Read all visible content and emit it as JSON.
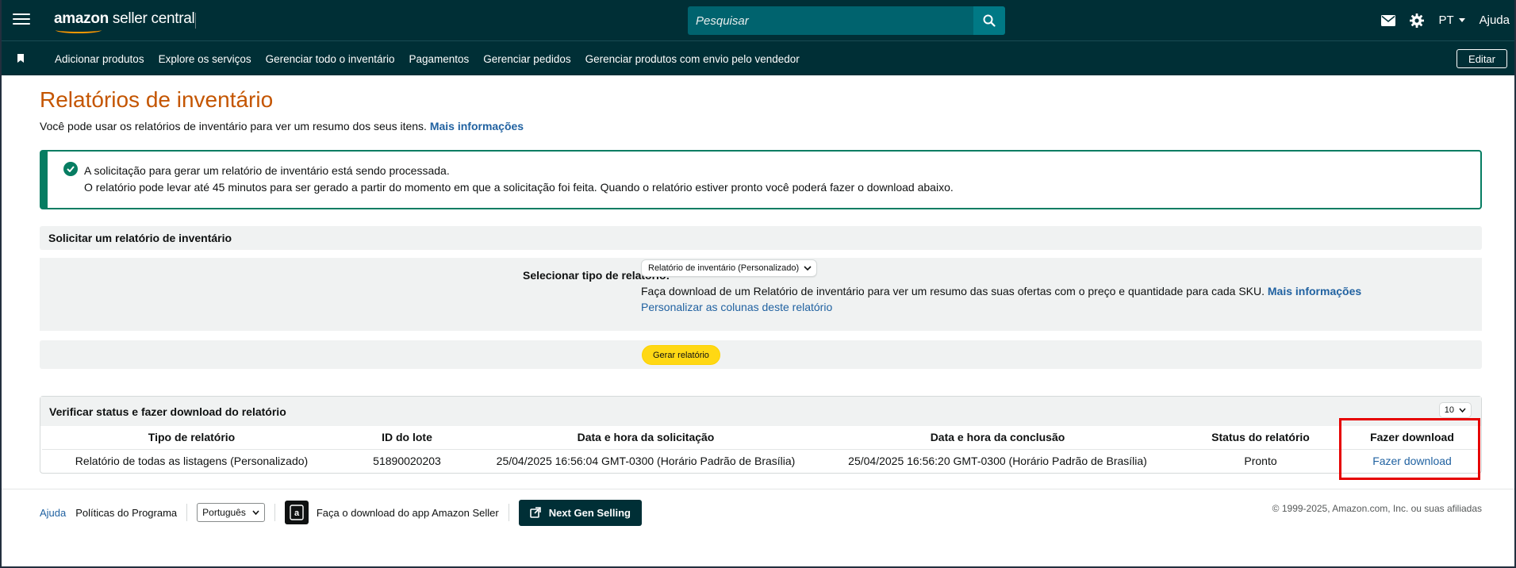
{
  "topbar": {
    "logo_prefix": "amazon",
    "logo_suffix": " seller central",
    "search_placeholder": "Pesquisar",
    "language": "PT",
    "help": "Ajuda"
  },
  "nav": {
    "items": [
      "Adicionar produtos",
      "Explore os serviços",
      "Gerenciar todo o inventário",
      "Pagamentos",
      "Gerenciar pedidos",
      "Gerenciar produtos com envio pelo vendedor"
    ],
    "edit": "Editar"
  },
  "page": {
    "title": "Relatórios de inventário",
    "subtitle": "Você pode usar os relatórios de inventário para ver um resumo dos seus itens.",
    "subtitle_link": "Mais informações"
  },
  "alert": {
    "line1": "A solicitação para gerar um relatório de inventário está sendo processada.",
    "line2": "O relatório pode levar até 45 minutos para ser gerado a partir do momento em que a solicitação foi feita. Quando o relatório estiver pronto você poderá fazer o download abaixo."
  },
  "request": {
    "heading": "Solicitar um relatório de inventário",
    "select_label": "Selecionar tipo de relatório:",
    "selected_type": "Relatório de inventário (Personalizado)",
    "description": "Faça download de um Relatório de inventário para ver um resumo das suas ofertas com o preço e quantidade para cada SKU.",
    "description_link": "Mais informações",
    "customize_link": "Personalizar as colunas deste relatório",
    "generate_button": "Gerar relatório"
  },
  "status": {
    "heading": "Verificar status e fazer download do relatório",
    "page_size": "10",
    "columns": [
      "Tipo de relatório",
      "ID do lote",
      "Data e hora da solicitação",
      "Data e hora da conclusão",
      "Status do relatório",
      "Fazer download"
    ],
    "rows": [
      {
        "type": "Relatório de todas as listagens (Personalizado)",
        "batch_id": "51890020203",
        "requested": "25/04/2025 16:56:04 GMT-0300 (Horário Padrão de Brasília)",
        "completed": "25/04/2025 16:56:20 GMT-0300 (Horário Padrão de Brasília)",
        "status": "Pronto",
        "download": "Fazer download"
      }
    ]
  },
  "footer": {
    "help": "Ajuda",
    "policies": "Políticas do Programa",
    "language": "Português",
    "app_download": "Faça o download do app Amazon Seller",
    "next_gen": "Next Gen Selling",
    "copyright": "© 1999-2025, Amazon.com, Inc. ou suas afiliadas"
  },
  "colors": {
    "header_bg": "#002f36",
    "title": "#c45500",
    "link": "#2162a1",
    "success": "#067d62",
    "primary_button": "#ffd814",
    "highlight": "#e60000"
  }
}
